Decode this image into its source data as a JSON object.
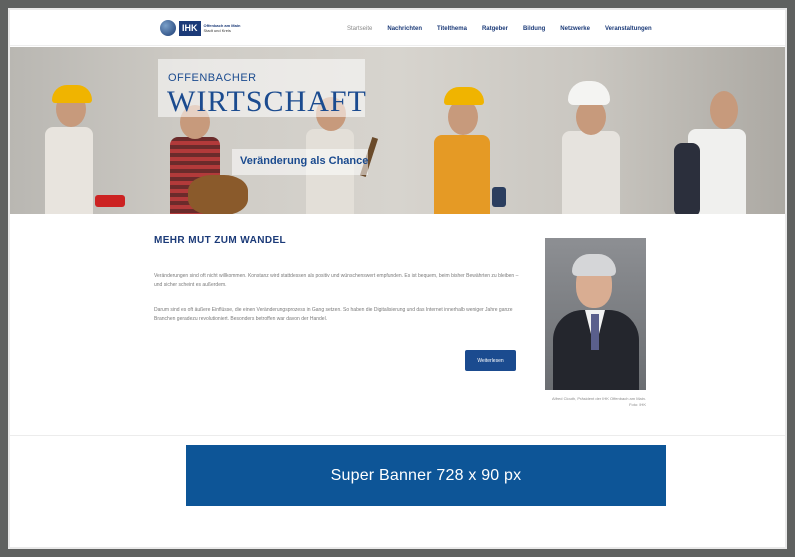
{
  "header": {
    "logo_badge": "IHK",
    "logo_line1": "Offenbach am Main",
    "logo_line2": "Stadt und Kreis",
    "nav": [
      "Startseite",
      "Nachrichten",
      "Titelthema",
      "Ratgeber",
      "Bildung",
      "Netzwerke",
      "Veranstaltungen"
    ]
  },
  "hero": {
    "title_small": "OFFENBACHER",
    "title_big": "WIRTSCHAFT",
    "subtitle": "Veränderung als Chance"
  },
  "article": {
    "heading": "MEHR MUT ZUM WANDEL",
    "paragraph1": "Veränderungen sind oft nicht willkommen. Konstanz wird stattdessen als positiv und wünschenswert empfunden. Es ist bequem, beim bisher Bewährten zu bleiben – und sicher scheint es außerdem.",
    "paragraph2": "Darum sind es oft äußere Einflüsse, die einen Veränderungsprozess in Gang setzen. So haben die Digitalisierung und das Internet innerhalb weniger Jahre ganze Branchen geradezu revolutioniert. Besonders betroffen war davon der Handel.",
    "button_label": "Weiterlesen",
    "photo_caption": "Alfred Clouth, Präsident der IHK Offenbach am Main. Foto: IHK"
  },
  "banner": {
    "label": "Super Banner 728 x 90 px"
  },
  "colors": {
    "brand_blue": "#1b3a78",
    "banner_blue": "#0d5597"
  }
}
